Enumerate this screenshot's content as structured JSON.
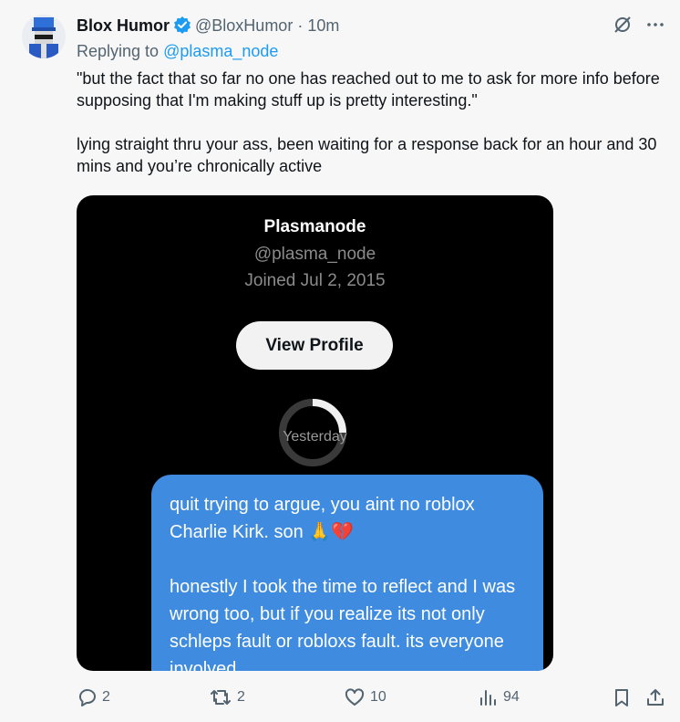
{
  "tweet": {
    "author_name": "Blox Humor",
    "author_handle": "@BloxHumor",
    "dot": "·",
    "time": "10m",
    "replying_prefix": "Replying to",
    "replying_to": "@plasma_node",
    "text": "\"but the fact that so far no one has reached out to me to ask for more info before supposing that I'm making stuff up is pretty interesting.\"\n\nlying straight thru your ass, been waiting for a response back for an hour and 30 mins and you’re chronically active"
  },
  "media": {
    "profile_name": "Plasmanode",
    "profile_handle": "@plasma_node",
    "joined": "Joined Jul 2, 2015",
    "view_profile_label": "View Profile",
    "date_label": "Yesterday",
    "message_para1": "quit trying to argue, you aint no roblox Charlie Kirk. son 🙏💔",
    "message_para2": "honestly I took the time to reflect and I was wrong too, but if you realize its not only schleps fault or robloxs fault. its everyone involved."
  },
  "actions": {
    "replies": "2",
    "reposts": "2",
    "likes": "10",
    "views": "94"
  },
  "colors": {
    "accent": "#1d9bf0",
    "bubble": "#3e8be0",
    "muted": "#536471"
  },
  "icons": [
    "grok-icon",
    "more-icon",
    "reply-icon",
    "repost-icon",
    "like-icon",
    "views-icon",
    "bookmark-icon",
    "share-icon",
    "verified-badge-icon"
  ]
}
